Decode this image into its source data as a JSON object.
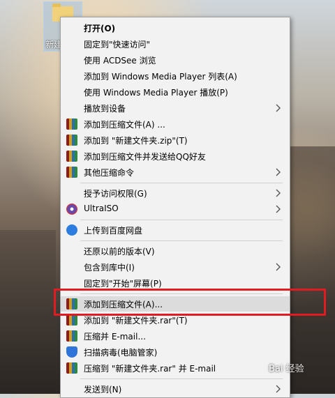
{
  "desktop": {
    "folder_label": "新建"
  },
  "menu": {
    "items": [
      {
        "label": "打开(O)",
        "bold": true
      },
      {
        "label": "固定到\"快速访问\""
      },
      {
        "label": "使用 ACDSee 浏览"
      },
      {
        "label": "添加到 Windows Media Player 列表(A)"
      },
      {
        "label": "使用 Windows Media Player 播放(P)"
      },
      {
        "label": "播放到设备"
      },
      {
        "label": "添加到压缩文件(A) ..."
      },
      {
        "label": "添加到 \"新建文件夹.zip\"(T)"
      },
      {
        "label": "添加到压缩文件并发送给QQ好友"
      },
      {
        "label": "其他压缩命令"
      },
      {
        "label": "授予访问权限(G)"
      },
      {
        "label": "UltraISO"
      },
      {
        "label": "上传到百度网盘"
      },
      {
        "label": "还原以前的版本(V)"
      },
      {
        "label": "包含到库中(I)"
      },
      {
        "label": "固定到\"开始\"屏幕(P)"
      },
      {
        "label": "添加到压缩文件(A)..."
      },
      {
        "label": "添加到 \"新建文件夹.rar\"(T)"
      },
      {
        "label": "压缩并 E-mail..."
      },
      {
        "label": "扫描病毒(电脑管家)"
      },
      {
        "label": "压缩到 \"新建文件夹.rar\" 并 E-mail"
      },
      {
        "label": "发送到(N)"
      }
    ]
  },
  "watermark": "Bai 经验",
  "colors": {
    "menu_bg": "#f2f2f2",
    "hover_bg": "#dcdcdc",
    "highlight_border": "#e11b22"
  }
}
